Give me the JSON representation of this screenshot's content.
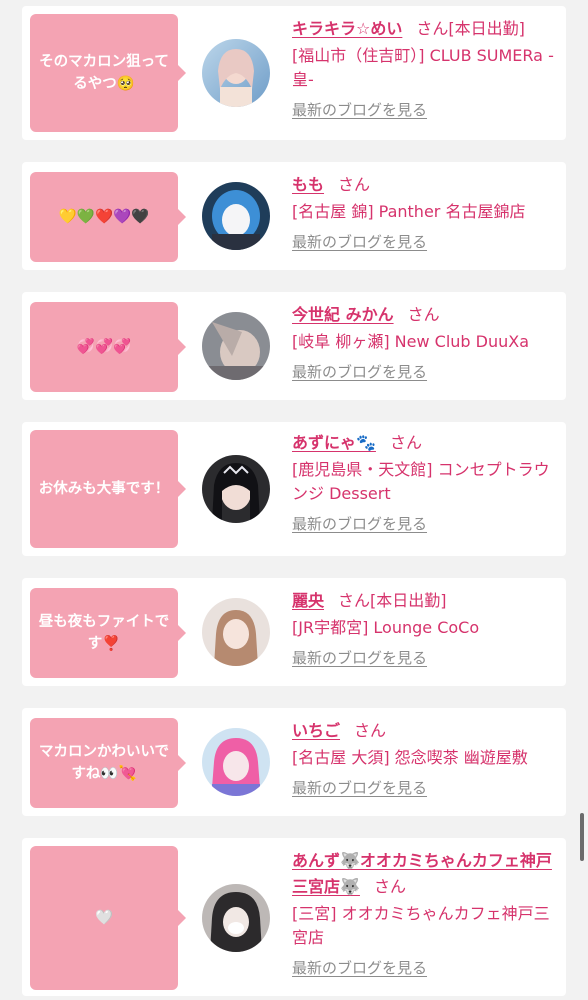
{
  "blog_link_label": "最新のブログを見る",
  "san_label": "さん",
  "colors": {
    "accent": "#d6336c",
    "bubble": "#f4a3b3",
    "link_gray": "#8c8c8c"
  },
  "entries": [
    {
      "comment": "そのマカロン狙ってるやつ🥺",
      "name": "キラキラ☆めい",
      "badge": "[本日出勤]",
      "shop": "[福山市（住吉町）] CLUB SUMERa -皇-"
    },
    {
      "comment": "💛💚❤️💜🖤",
      "name": "もも",
      "badge": "",
      "shop": "[名古屋 錦] Panther 名古屋錦店"
    },
    {
      "comment": "💞💞💞",
      "name": "今世紀 みかん",
      "badge": "",
      "shop": "[岐阜 柳ヶ瀬] New Club DuuXa"
    },
    {
      "comment": "お休みも大事です！",
      "name": "あずにゃ🐾",
      "badge": "",
      "shop": "[鹿児島県・天文館] コンセプトラウンジ Dessert"
    },
    {
      "comment": "昼も夜もファイトです❣️",
      "name": "麗央",
      "badge": "[本日出勤]",
      "shop": "[JR宇都宮] Lounge CoCo"
    },
    {
      "comment": "マカロンかわいいですね👀💘",
      "name": "いちご",
      "badge": "",
      "shop": "[名古屋 大須] 怨念喫茶 幽遊屋敷"
    },
    {
      "comment": "🤍",
      "name": "あんず🐺オオカミちゃんカフェ神戸三宮店🐺",
      "badge": "",
      "shop": "[三宮] オオカミちゃんカフェ神戸三宮店"
    }
  ]
}
